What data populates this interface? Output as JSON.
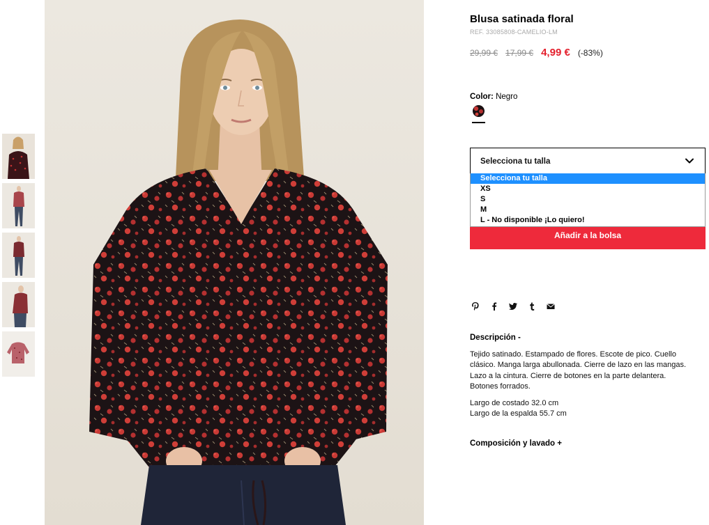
{
  "product": {
    "title": "Blusa satinada floral",
    "ref": "REF. 33085808-CAMELIO-LM",
    "price_original": "29,99 €",
    "price_previous": "17,99 €",
    "price_sale": "4,99 €",
    "discount": "(-83%)"
  },
  "color": {
    "label": "Color:",
    "value": "Negro"
  },
  "size": {
    "selected": "Selecciona tu talla",
    "options": [
      "Selecciona tu talla",
      "XS",
      "S",
      "M",
      "L - No disponible ¡Lo quiero!"
    ]
  },
  "add_to_bag": "Añadir a la bolsa",
  "share_icons": [
    "pinterest-icon",
    "facebook-icon",
    "twitter-icon",
    "tumblr-icon",
    "email-icon"
  ],
  "description": {
    "title": "Descripción -",
    "text": "Tejido satinado. Estampado de flores. Escote de pico. Cuello clásico. Manga larga abullonada. Cierre de lazo en las mangas. Lazo a la cintura. Cierre de botones en la parte delantera. Botones forrados.",
    "measure_1": "Largo de costado 32.0 cm",
    "measure_2": "Largo de la espalda 55.7 cm"
  },
  "composition_title": "Composición y lavado +",
  "colors": {
    "sale": "#e4212e",
    "button": "#ee2a3b",
    "dropdown_highlight": "#1e90ff"
  }
}
